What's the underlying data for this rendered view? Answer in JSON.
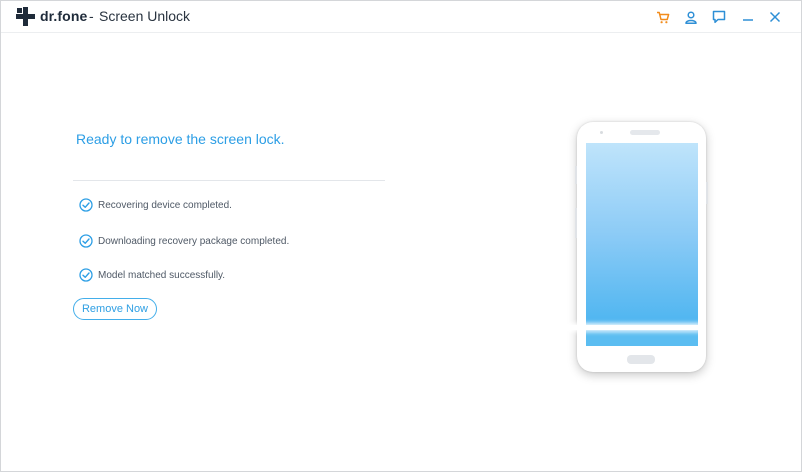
{
  "titlebar": {
    "brand": "dr.fone",
    "separator": "-",
    "title": "Screen Unlock",
    "icons": {
      "logo": "drfone-plus-logo",
      "cart": "cart-icon",
      "account": "user-icon",
      "feedback": "chat-icon",
      "minimize": "minimize-icon",
      "close": "close-icon"
    },
    "colors": {
      "cart": "#f28c1c",
      "icons": "#2e8fd6",
      "logo": "#1f2b3a"
    }
  },
  "main": {
    "headline": "Ready to remove the screen lock.",
    "steps": [
      {
        "label": "Recovering device completed.",
        "status": "complete"
      },
      {
        "label": "Downloading recovery package completed.",
        "status": "complete"
      },
      {
        "label": "Model matched successfully.",
        "status": "complete"
      }
    ],
    "remove_button": "Remove Now",
    "accent": "#2c9ee5"
  }
}
